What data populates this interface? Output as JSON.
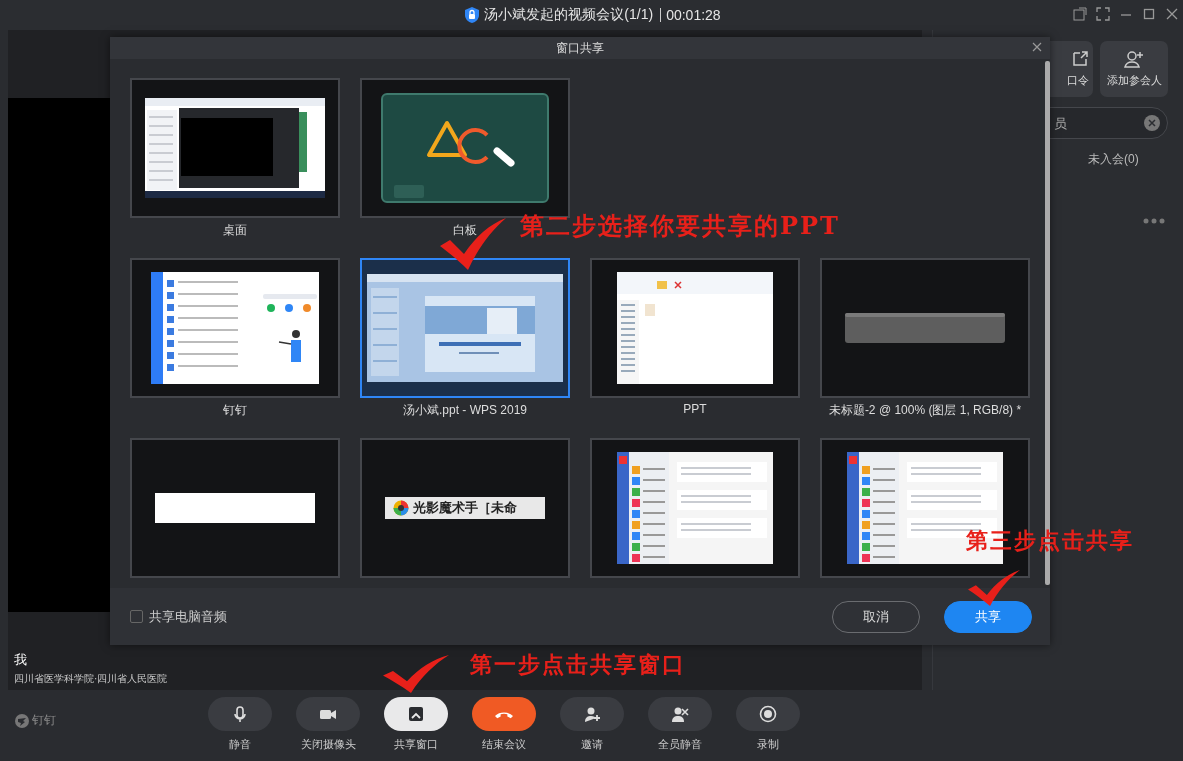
{
  "window": {
    "title": "汤小斌发起的视频会议(1/1)",
    "timer": "00:01:28"
  },
  "stage": {
    "name": "我",
    "org": "四川省医学科学院·四川省人民医院"
  },
  "side_panel": {
    "buttons": [
      {
        "label": "口令"
      },
      {
        "label": "添加参会人"
      }
    ],
    "search": {
      "placeholder": "员"
    },
    "tab": "未入会(0)"
  },
  "app_badge": "钉钉",
  "toolbar": [
    {
      "label": "静音",
      "kind": "default"
    },
    {
      "label": "关闭摄像头",
      "kind": "default"
    },
    {
      "label": "共享窗口",
      "kind": "highlight"
    },
    {
      "label": "结束会议",
      "kind": "danger"
    },
    {
      "label": "邀请",
      "kind": "default"
    },
    {
      "label": "全员静音",
      "kind": "default"
    },
    {
      "label": "录制",
      "kind": "default"
    }
  ],
  "share_dialog": {
    "title": "窗口共享",
    "tile_rows": [
      [
        {
          "label": "桌面",
          "kind": "desktop",
          "selected": false
        },
        {
          "label": "白板",
          "kind": "whiteboard",
          "selected": false
        }
      ],
      [
        {
          "label": "钉钉",
          "kind": "list-app",
          "selected": false
        },
        {
          "label": "汤小斌.ppt - WPS 2019",
          "kind": "slides",
          "selected": true
        },
        {
          "label": "PPT",
          "kind": "explorer",
          "selected": false
        },
        {
          "label": "未标题-2 @ 100% (图层 1, RGB/8) *",
          "kind": "dark-bar",
          "selected": false
        }
      ],
      [
        {
          "kind": "white-bar",
          "selected": false
        },
        {
          "kind": "titled-bar",
          "caption": "光影魔术手［未命",
          "selected": false
        },
        {
          "kind": "chat-app",
          "selected": false
        },
        {
          "kind": "chat-app",
          "selected": false
        }
      ]
    ],
    "audio": {
      "label": "共享电脑音频",
      "checked": false
    },
    "buttons": [
      {
        "label": "取消",
        "kind": "secondary"
      },
      {
        "label": "共享",
        "kind": "primary"
      }
    ]
  },
  "annotations": [
    {
      "text": "第二步选择你要共享的PPT"
    },
    {
      "text": "第三步点击共享"
    },
    {
      "text": "第一步点击共享窗口"
    }
  ]
}
